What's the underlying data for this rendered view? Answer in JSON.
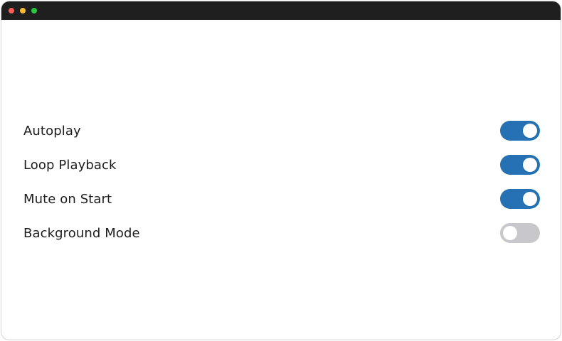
{
  "window": {
    "controls": [
      "close",
      "minimize",
      "zoom"
    ]
  },
  "settings": [
    {
      "label": "Autoplay",
      "enabled": true
    },
    {
      "label": "Loop Playback",
      "enabled": true
    },
    {
      "label": "Mute on Start",
      "enabled": true
    },
    {
      "label": "Background Mode",
      "enabled": false
    }
  ],
  "colors": {
    "toggle_on": "#2671b4",
    "toggle_off": "#c8c8cc",
    "titlebar": "#1f1f20",
    "close": "#ff5f57",
    "minimize": "#febc2e",
    "zoom": "#28c840"
  }
}
